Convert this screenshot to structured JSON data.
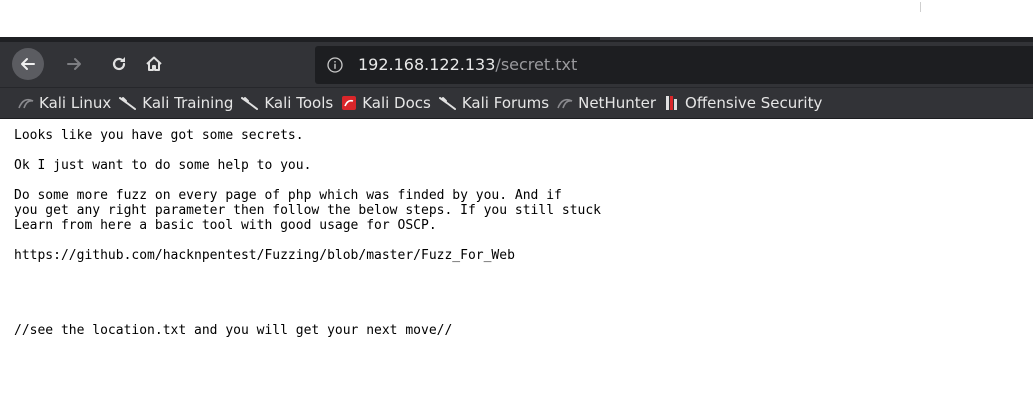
{
  "browser": {
    "url_host": "192.168.122.133",
    "url_path": "/secret.txt"
  },
  "bookmarks": [
    {
      "label": "Kali Linux",
      "icon": "kali-dragon-icon"
    },
    {
      "label": "Kali Training",
      "icon": "kali-dragon-icon"
    },
    {
      "label": "Kali Tools",
      "icon": "kali-dragon-icon"
    },
    {
      "label": "Kali Docs",
      "icon": "kali-docs-icon"
    },
    {
      "label": "Kali Forums",
      "icon": "kali-dragon-icon"
    },
    {
      "label": "NetHunter",
      "icon": "nethunter-icon"
    },
    {
      "label": "Offensive Security",
      "icon": "offsec-icon"
    }
  ],
  "page": {
    "lines": [
      "Looks like you have got some secrets.",
      "Ok I just want to do some help to you.",
      "Do some more fuzz on every page of php which was finded by you. And if",
      "you get any right parameter then follow the below steps. If you still stuck",
      "Learn from here a basic tool with good usage for OSCP.",
      "https://github.com/hacknpentest/Fuzzing/blob/master/Fuzz_For_Web",
      "//see the location.txt and you will get your next move//"
    ]
  }
}
